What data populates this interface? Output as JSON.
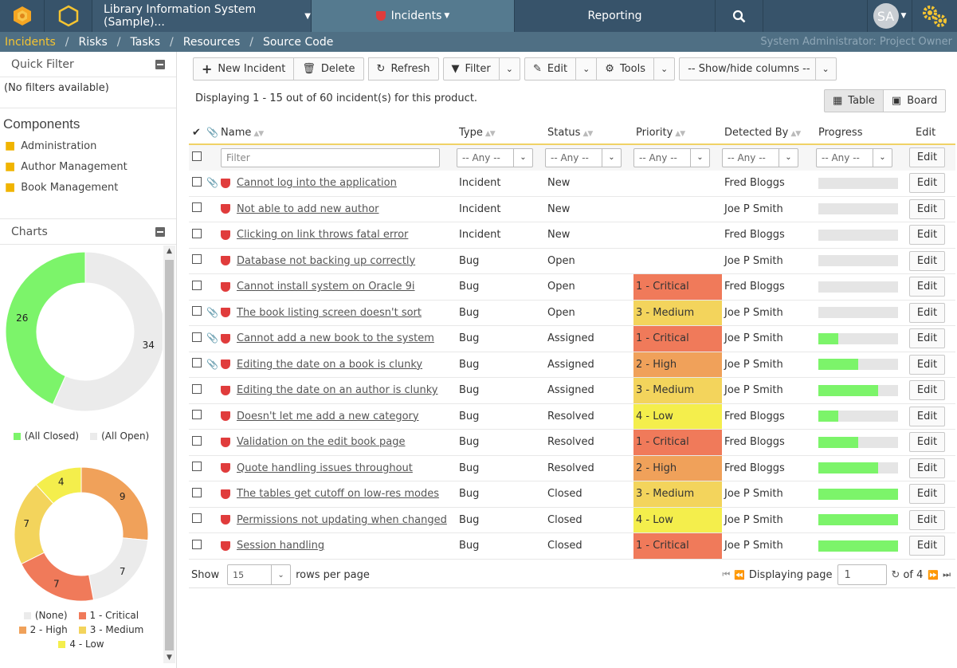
{
  "topbar": {
    "project": "Library Information System (Sample)...",
    "incidents": "Incidents",
    "reporting": "Reporting",
    "avatar": "SA"
  },
  "nav": {
    "items": [
      "Incidents",
      "Risks",
      "Tasks",
      "Resources",
      "Source Code"
    ],
    "user": "System Administrator: Project Owner"
  },
  "sidebar": {
    "quick_filter": "Quick Filter",
    "no_filters": "(No filters available)",
    "components_title": "Components",
    "components": [
      "Administration",
      "Author Management",
      "Book Management"
    ],
    "charts_title": "Charts"
  },
  "chart_data": [
    {
      "type": "pie",
      "categories": [
        "(All Closed)",
        "(All Open)"
      ],
      "values": [
        26,
        34
      ],
      "colors": [
        "#7cf46a",
        "#ebebeb"
      ]
    },
    {
      "type": "pie",
      "categories": [
        "(None)",
        "1 - Critical",
        "2 - High",
        "3 - Medium",
        "4 - Low"
      ],
      "values": [
        7,
        7,
        9,
        7,
        4
      ],
      "order": [
        "3 - Medium",
        "2 - High",
        "(None)",
        "1 - Critical",
        "3 - Medium b"
      ],
      "colors": [
        "#ebebeb",
        "#f07a5a",
        "#f0a15a",
        "#f3d45c",
        "#f4ee4c"
      ]
    }
  ],
  "toolbar": {
    "new_incident": "New Incident",
    "delete": "Delete",
    "refresh": "Refresh",
    "filter": "Filter",
    "edit": "Edit",
    "tools": "Tools",
    "show_hide": "-- Show/hide columns --"
  },
  "display_info": "Displaying 1 - 15 out of 60 incident(s) for this product.",
  "view": {
    "table": "Table",
    "board": "Board"
  },
  "columns": {
    "name": "Name",
    "type": "Type",
    "status": "Status",
    "priority": "Priority",
    "detected_by": "Detected By",
    "progress": "Progress",
    "edit": "Edit"
  },
  "filters": {
    "name_placeholder": "Filter",
    "any": "-- Any --",
    "edit": "Edit"
  },
  "colors": {
    "critical": "#f07a5a",
    "high": "#f0a15a",
    "medium": "#f3d45c",
    "low": "#f4ee4c"
  },
  "rows": [
    {
      "attach": true,
      "name": "Cannot log into the application",
      "type": "Incident",
      "status": "New",
      "priority": "",
      "detected_by": "Fred Bloggs",
      "progress": 0
    },
    {
      "attach": false,
      "name": "Not able to add new author",
      "type": "Incident",
      "status": "New",
      "priority": "",
      "detected_by": "Joe P Smith",
      "progress": 0
    },
    {
      "attach": false,
      "name": "Clicking on link throws fatal error",
      "type": "Incident",
      "status": "New",
      "priority": "",
      "detected_by": "Fred Bloggs",
      "progress": 0
    },
    {
      "attach": false,
      "name": "Database not backing up correctly",
      "type": "Bug",
      "status": "Open",
      "priority": "",
      "detected_by": "Joe P Smith",
      "progress": 0
    },
    {
      "attach": false,
      "name": "Cannot install system on Oracle 9i",
      "type": "Bug",
      "status": "Open",
      "priority": "1 - Critical",
      "detected_by": "Fred Bloggs",
      "progress": 0
    },
    {
      "attach": true,
      "name": "The book listing screen doesn't sort",
      "type": "Bug",
      "status": "Open",
      "priority": "3 - Medium",
      "detected_by": "Joe P Smith",
      "progress": 0
    },
    {
      "attach": true,
      "name": "Cannot add a new book to the system",
      "type": "Bug",
      "status": "Assigned",
      "priority": "1 - Critical",
      "detected_by": "Joe P Smith",
      "progress": 25
    },
    {
      "attach": true,
      "name": "Editing the date on a book is clunky",
      "type": "Bug",
      "status": "Assigned",
      "priority": "2 - High",
      "detected_by": "Joe P Smith",
      "progress": 50
    },
    {
      "attach": false,
      "name": "Editing the date on an author is clunky",
      "type": "Bug",
      "status": "Assigned",
      "priority": "3 - Medium",
      "detected_by": "Joe P Smith",
      "progress": 75
    },
    {
      "attach": false,
      "name": "Doesn't let me add a new category",
      "type": "Bug",
      "status": "Resolved",
      "priority": "4 - Low",
      "detected_by": "Fred Bloggs",
      "progress": 25
    },
    {
      "attach": false,
      "name": "Validation on the edit book page",
      "type": "Bug",
      "status": "Resolved",
      "priority": "1 - Critical",
      "detected_by": "Fred Bloggs",
      "progress": 50
    },
    {
      "attach": false,
      "name": "Quote handling issues throughout",
      "type": "Bug",
      "status": "Resolved",
      "priority": "2 - High",
      "detected_by": "Fred Bloggs",
      "progress": 75
    },
    {
      "attach": false,
      "name": "The tables get cutoff on low-res modes",
      "type": "Bug",
      "status": "Closed",
      "priority": "3 - Medium",
      "detected_by": "Joe P Smith",
      "progress": 100
    },
    {
      "attach": false,
      "name": "Permissions not updating when changed",
      "type": "Bug",
      "status": "Closed",
      "priority": "4 - Low",
      "detected_by": "Joe P Smith",
      "progress": 100
    },
    {
      "attach": false,
      "name": "Session handling",
      "type": "Bug",
      "status": "Closed",
      "priority": "1 - Critical",
      "detected_by": "Joe P Smith",
      "progress": 100
    }
  ],
  "pager": {
    "show": "Show",
    "rows_value": "15",
    "rows_per_page": "rows per page",
    "displaying_page": "Displaying page",
    "page": "1",
    "of": "of 4"
  }
}
